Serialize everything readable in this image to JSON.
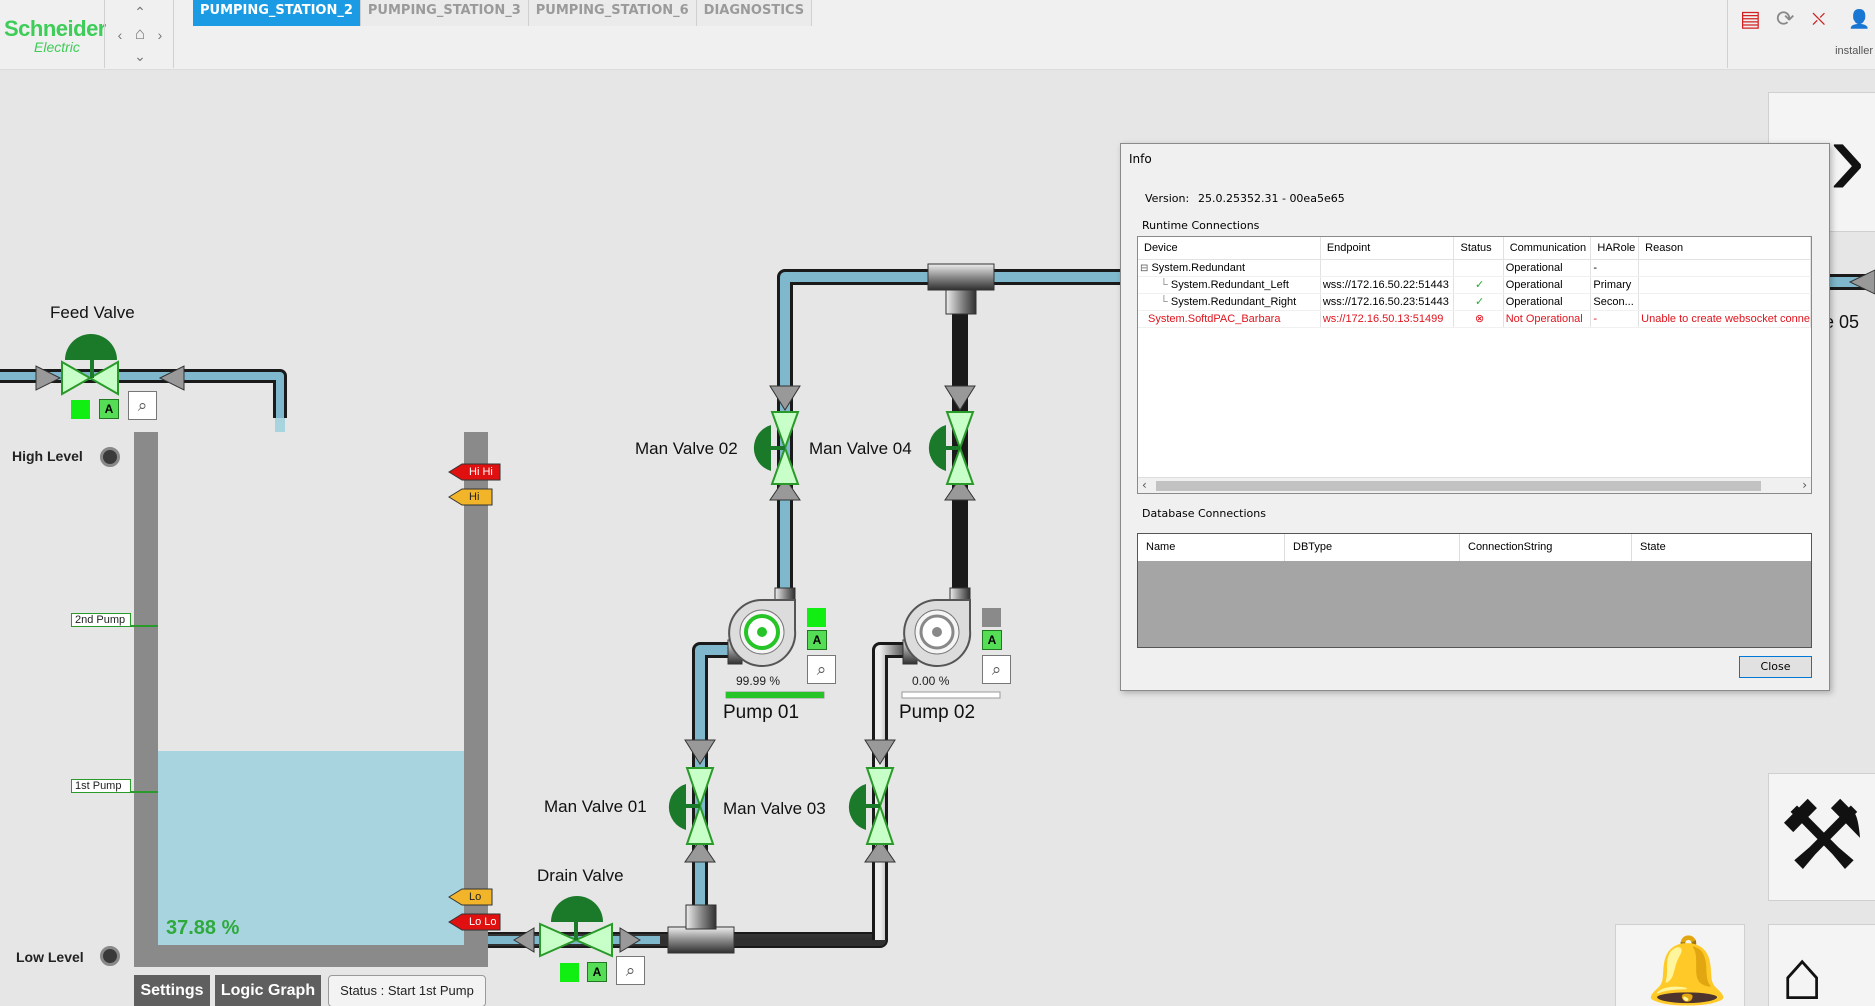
{
  "header": {
    "brand_line1": "Schneider",
    "brand_line2": "Electric",
    "tabs": [
      {
        "label": "PUMPING_STATION_2",
        "active": true
      },
      {
        "label": "PUMPING_STATION_3",
        "active": false
      },
      {
        "label": "PUMPING_STATION_6",
        "active": false
      },
      {
        "label": "DIAGNOSTICS",
        "active": false
      }
    ],
    "user": "installer"
  },
  "process": {
    "feed_valve": "Feed Valve",
    "drain_valve": "Drain Valve",
    "man_valve_01": "Man Valve 01",
    "man_valve_02": "Man Valve 02",
    "man_valve_03": "Man Valve 03",
    "man_valve_04": "Man Valve 04",
    "pump_01": "Pump 01",
    "pump_02": "Pump 02",
    "pump_01_speed": "99.99 %",
    "pump_02_speed": "0.00 %",
    "pump_01_speed_fraction": 0.9999,
    "pump_02_speed_fraction": 0.0,
    "high_level": "High Level",
    "low_level": "Low Level",
    "tank_level": "37.88 %",
    "tank_level_fraction": 0.3788,
    "tag_2nd_pump": "2nd Pump",
    "tag_1st_pump": "1st Pump",
    "alarm_hihi": "Hi Hi",
    "alarm_hi": "Hi",
    "alarm_lo": "Lo",
    "alarm_lolo": "Lo Lo",
    "mode_auto": "A",
    "partial_label": "e 05"
  },
  "footer": {
    "settings": "Settings",
    "logic_graph": "Logic Graph",
    "status": "Status : Start 1st Pump"
  },
  "dialog": {
    "title": "Info",
    "version_label": "Version:",
    "version_value": "25.0.25352.31 - 00ea5e65",
    "runtime_group": "Runtime Connections",
    "runtime_columns": [
      "Device",
      "Endpoint",
      "Status",
      "Communication",
      "HARole",
      "Reason"
    ],
    "runtime_rows": [
      {
        "device": "System.Redundant",
        "endpoint": "",
        "communication": "Operational",
        "harole": "-",
        "reason": ""
      },
      {
        "device": "System.Redundant_Left",
        "endpoint": "wss://172.16.50.22:51443",
        "communication": "Operational",
        "harole": "Primary",
        "reason": ""
      },
      {
        "device": "System.Redundant_Right",
        "endpoint": "wss://172.16.50.23:51443",
        "communication": "Operational",
        "harole": "Secon...",
        "reason": ""
      },
      {
        "device": "System.SoftdPAC_Barbara",
        "endpoint": "ws://172.16.50.13:51499",
        "communication": "Not Operational",
        "harole": "-",
        "reason": "Unable to create websocket conne"
      }
    ],
    "db_group": "Database Connections",
    "db_columns": [
      "Name",
      "DBType",
      "ConnectionString",
      "State"
    ],
    "close_label": "Close"
  },
  "colors": {
    "accent_tab": "#1a9be3",
    "valve_green": "#1b7a2a",
    "valve_body": "#c8ffc8",
    "water": "#a8d4e0",
    "pipe_water": "#7fb8cc",
    "alarm_red": "#e01010",
    "alarm_yellow": "#f2b52a",
    "error_red": "#e0141e"
  }
}
